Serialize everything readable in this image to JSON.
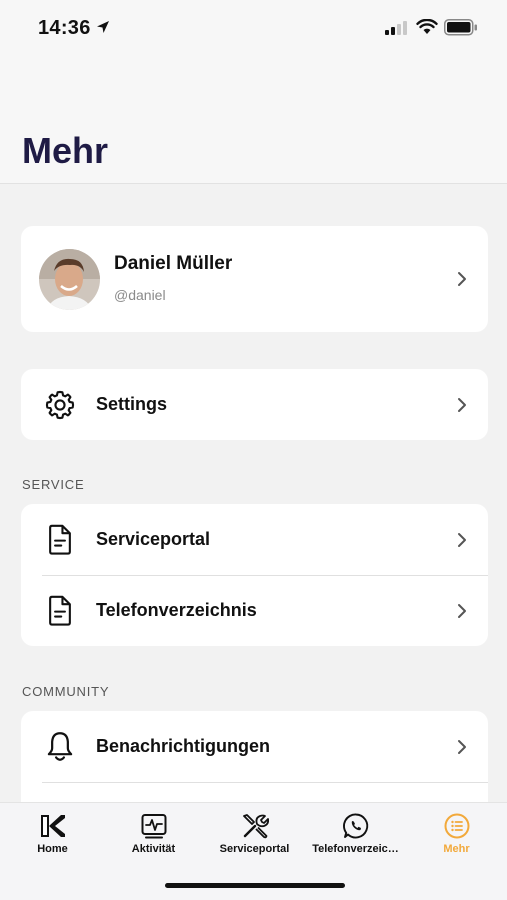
{
  "status_bar": {
    "time": "14:36",
    "icons": [
      "location-arrow-icon",
      "cellular-signal-icon",
      "wifi-icon",
      "battery-icon"
    ]
  },
  "page": {
    "title": "Mehr"
  },
  "profile": {
    "name": "Daniel Müller",
    "handle": "@daniel"
  },
  "settings": {
    "label": "Settings",
    "icon": "gear-icon"
  },
  "service": {
    "header": "SERVICE",
    "items": [
      {
        "label": "Serviceportal",
        "icon": "document-icon"
      },
      {
        "label": "Telefonverzeichnis",
        "icon": "document-icon"
      }
    ]
  },
  "community": {
    "header": "COMMUNITY",
    "items": [
      {
        "label": "Benachrichtigungen",
        "icon": "bell-icon"
      }
    ]
  },
  "tabbar": {
    "tabs": [
      {
        "label": "Home",
        "icon": "brand-logo-icon"
      },
      {
        "label": "Aktivität",
        "icon": "activity-icon"
      },
      {
        "label": "Serviceportal",
        "icon": "tools-icon"
      },
      {
        "label": "Telefonverzeic…",
        "icon": "phone-icon"
      },
      {
        "label": "Mehr",
        "icon": "list-icon"
      }
    ],
    "active_tab": "Mehr"
  },
  "colors": {
    "title": "#1f1b45",
    "accent": "#f2a93b",
    "background": "#f2f2f2",
    "card": "#ffffff"
  }
}
